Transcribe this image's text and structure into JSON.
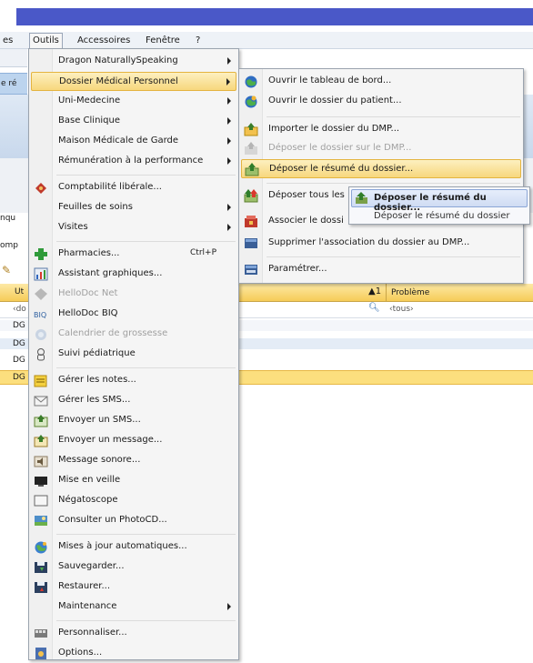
{
  "menubar": {
    "items": [
      "es",
      "Outils",
      "Accessoires",
      "Fenêtre",
      "?"
    ]
  },
  "background": {
    "toolbar_text": "e ré",
    "label_inqu": "nqu",
    "label_comp": "omp",
    "grid_col1": "Ut",
    "grid_col2": "Problème",
    "grid_sort": "▲1",
    "filter1": "‹do",
    "filter2": "‹tous›",
    "rows": [
      "DG",
      "DG",
      "DG",
      "DG"
    ]
  },
  "outils_menu": {
    "items": [
      {
        "label": "Dragon NaturallySpeaking",
        "submenu": true,
        "icon": "none"
      },
      {
        "label": "Dossier Médical Personnel",
        "submenu": true,
        "icon": "none",
        "highlighted": true
      },
      {
        "label": "Uni-Medecine",
        "submenu": true,
        "icon": "none"
      },
      {
        "label": "Base Clinique",
        "submenu": true,
        "icon": "none"
      },
      {
        "label": "Maison Médicale de Garde",
        "submenu": true,
        "icon": "none"
      },
      {
        "label": "Rémunération à la performance",
        "submenu": true,
        "icon": "none"
      },
      {
        "label": "Comptabilité libérale...",
        "icon": "accounting-icon"
      },
      {
        "label": "Feuilles de soins",
        "submenu": true,
        "icon": "none"
      },
      {
        "label": "Visites",
        "submenu": true,
        "icon": "none"
      },
      {
        "label": "Pharmacies...",
        "shortcut": "Ctrl+P",
        "icon": "pharmacy-cross-icon"
      },
      {
        "label": "Assistant graphiques...",
        "icon": "chart-icon"
      },
      {
        "label": "HelloDoc Net",
        "disabled": true,
        "icon": "diamond-icon"
      },
      {
        "label": "HelloDoc BIQ",
        "icon": "biq-icon"
      },
      {
        "label": "Calendrier de grossesse",
        "disabled": true,
        "icon": "calendar-icon"
      },
      {
        "label": "Suivi pédiatrique",
        "icon": "baby-icon"
      },
      {
        "label": "Gérer les notes...",
        "icon": "notes-icon"
      },
      {
        "label": "Gérer les SMS...",
        "icon": "sms-icon"
      },
      {
        "label": "Envoyer un SMS...",
        "icon": "send-sms-icon"
      },
      {
        "label": "Envoyer un message...",
        "icon": "send-message-icon"
      },
      {
        "label": "Message sonore...",
        "icon": "sound-icon"
      },
      {
        "label": "Mise en veille",
        "icon": "standby-icon"
      },
      {
        "label": "Négatoscope",
        "icon": "negatoscope-icon"
      },
      {
        "label": "Consulter un PhotoCD...",
        "icon": "photocd-icon"
      },
      {
        "label": "Mises à jour automatiques...",
        "icon": "update-globe-icon"
      },
      {
        "label": "Sauvegarder...",
        "icon": "save-icon"
      },
      {
        "label": "Restaurer...",
        "icon": "restore-icon"
      },
      {
        "label": "Maintenance",
        "submenu": true,
        "icon": "none"
      },
      {
        "label": "Personnaliser...",
        "icon": "customize-icon"
      },
      {
        "label": "Options...",
        "icon": "options-icon"
      }
    ]
  },
  "dmp_menu": {
    "items": [
      {
        "label": "Ouvrir le tableau de bord...",
        "icon": "globe-icon"
      },
      {
        "label": "Ouvrir le dossier du patient...",
        "icon": "globe-patient-icon"
      },
      {
        "label": "Importer le dossier du DMP...",
        "icon": "import-icon"
      },
      {
        "label": "Déposer le dossier sur le DMP...",
        "disabled": true,
        "icon": "upload-folder-icon"
      },
      {
        "label": "Déposer le résumé du dossier...",
        "icon": "upload-summary-icon",
        "highlighted": true
      },
      {
        "label": "Déposer tous les",
        "icon": "upload-all-icon"
      },
      {
        "label": "Associer le dossi",
        "icon": "associate-icon"
      },
      {
        "label": "Supprimer l'association du dossier au DMP...",
        "icon": "delete-association-icon"
      },
      {
        "label": "Paramétrer...",
        "icon": "settings-icon"
      }
    ]
  },
  "tooltip": {
    "item_label": "Déposer le résumé du dossier...",
    "text": "Déposer le résumé du dossier"
  }
}
